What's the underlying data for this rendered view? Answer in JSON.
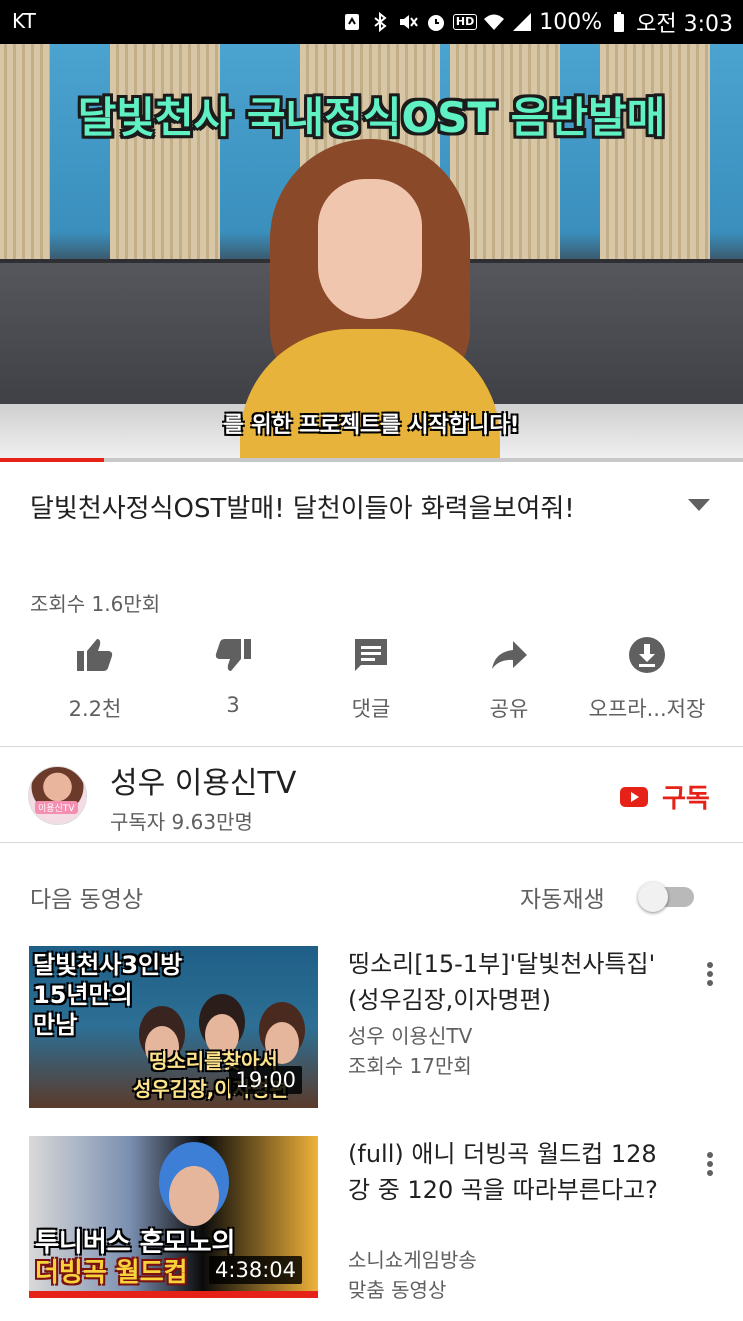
{
  "status_bar": {
    "carrier": "KT",
    "battery": "100%",
    "time": "오전 3:03",
    "icons": [
      "nfc-icon",
      "bluetooth-icon",
      "mute-icon",
      "alarm-icon",
      "hd-icon",
      "wifi-icon",
      "signal-icon",
      "battery-icon"
    ],
    "hd_label": "HD"
  },
  "player": {
    "overlay_title": "달빛천사 국내정식OST 음반발매",
    "subtitle": "를 위한 프로젝트를 시작합니다!",
    "progress": 0.14,
    "progress_color": "#e62117"
  },
  "video": {
    "title": "달빛천사정식OST발매! 달천이들아 화력을보여줘!",
    "views": "조회수 1.6만회"
  },
  "actions": [
    {
      "icon": "thumbs-up-icon",
      "label": "2.2천"
    },
    {
      "icon": "thumbs-down-icon",
      "label": "3"
    },
    {
      "icon": "comment-icon",
      "label": "댓글"
    },
    {
      "icon": "share-icon",
      "label": "공유"
    },
    {
      "icon": "download-icon",
      "label": "오프라...저장"
    }
  ],
  "channel": {
    "name": "성우 이용신TV",
    "subscribers": "구독자 9.63만명",
    "avatar_tag": "이용신TV",
    "subscribe_label": "구독"
  },
  "next_up": {
    "label": "다음 동영상",
    "autoplay_label": "자동재생",
    "autoplay_on": false
  },
  "videos": [
    {
      "title": "띵소리[15-1부]'달빛천사특집' (성우김장,이자명편)",
      "channel": "성우 이용신TV",
      "meta": "조회수 17만회",
      "duration": "19:00",
      "thumb_lines": [
        "달빛천사3인방",
        "15년만의",
        "만남"
      ],
      "thumb_caption_1": "띵소리를찾아서",
      "thumb_caption_2": "성우김장,이자명편"
    },
    {
      "title": "(full) 애니 더빙곡 월드컵 128강 중 120 곡을 따라부른다고?",
      "channel": "소니쇼게임방송",
      "meta": "맞춤 동영상",
      "duration": "4:38:04",
      "thumb_caption_1": "투니버스 혼모노의",
      "thumb_caption_2": "더빙곡 월드컵"
    }
  ],
  "colors": {
    "accent": "#e62117",
    "text_primary": "#212121",
    "text_secondary": "#606060",
    "overlay_title": "#5ff0c4"
  }
}
